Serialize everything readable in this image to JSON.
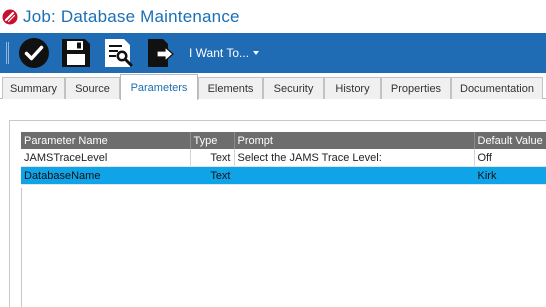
{
  "window": {
    "title": "Job: Database Maintenance"
  },
  "toolbar": {
    "buttons": [
      {
        "icon": "checkmark-circle-icon"
      },
      {
        "icon": "save-floppy-icon"
      },
      {
        "icon": "document-search-icon"
      },
      {
        "icon": "export-arrow-icon"
      }
    ],
    "menu_label": "I Want To..."
  },
  "tabs": [
    {
      "label": "Summary"
    },
    {
      "label": "Source"
    },
    {
      "label": "Parameters",
      "active": true
    },
    {
      "label": "Elements"
    },
    {
      "label": "Security"
    },
    {
      "label": "History"
    },
    {
      "label": "Properties"
    },
    {
      "label": "Documentation"
    }
  ],
  "grid": {
    "columns": [
      "Parameter Name",
      "Type",
      "Prompt",
      "Default Value"
    ],
    "rows": [
      {
        "name": "JAMSTraceLevel",
        "type": "Text",
        "prompt": "Select the JAMS Trace Level:",
        "default": "Off",
        "selected": false
      },
      {
        "name": "DatabaseName",
        "type": "Text",
        "prompt": "",
        "default": "Kirk",
        "selected": true
      }
    ]
  },
  "colors": {
    "toolbar": "#1f6bb4",
    "title": "#1b6fb5",
    "selection": "#0fa4e8",
    "header": "#6d6d6d"
  }
}
